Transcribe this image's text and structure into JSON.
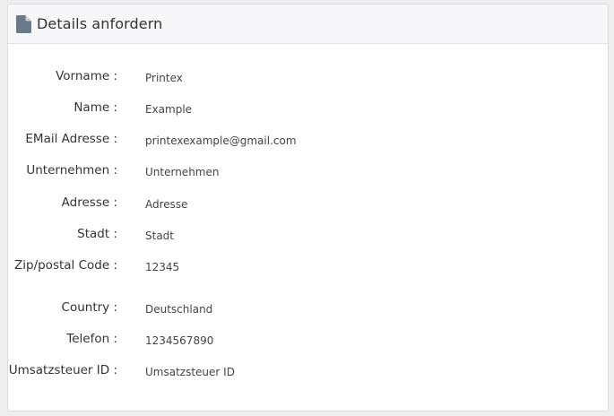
{
  "panel": {
    "icon": "document-icon",
    "title": "Details anfordern"
  },
  "fields": [
    {
      "label": "Vorname :",
      "value": "Printex"
    },
    {
      "label": "Name :",
      "value": "Example"
    },
    {
      "label": "EMail Adresse :",
      "value": "printexexample@gmail.com"
    },
    {
      "label": "Unternehmen :",
      "value": "Unternehmen"
    },
    {
      "label": "Adresse :",
      "value": "Adresse"
    },
    {
      "label": "Stadt :",
      "value": "Stadt"
    },
    {
      "label": "Zip/postal Code :",
      "value": "12345"
    },
    {
      "label": "Country :",
      "value": "Deutschland"
    },
    {
      "label": "Telefon :",
      "value": "1234567890"
    },
    {
      "label": "Umsatzsteuer ID :",
      "value": "Umsatzsteuer ID"
    }
  ],
  "colors": {
    "icon": "#6b7a89",
    "text": "#333333"
  }
}
